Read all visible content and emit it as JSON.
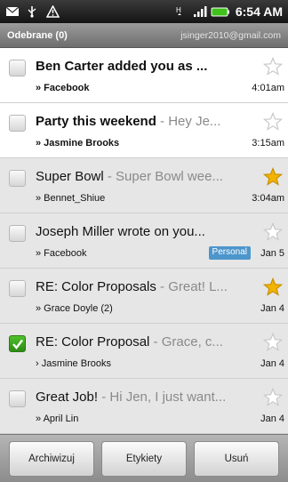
{
  "status_bar": {
    "time": "6:54 AM",
    "left_icons": [
      "mail-icon",
      "usb-icon",
      "warning-icon"
    ],
    "right_icons": [
      "data-icon",
      "signal-icon",
      "battery-icon"
    ]
  },
  "header": {
    "folder": "Odebrane (0)",
    "account": "jsinger2010@gmail.com"
  },
  "messages": [
    {
      "subject": "Ben Carter added you as ...",
      "snippet": "",
      "sender": "» Facebook",
      "time": "4:01am",
      "starred": false,
      "checked": false,
      "unread": true,
      "label": ""
    },
    {
      "subject": "Party this weekend",
      "snippet": " - Hey Je...",
      "sender": "» Jasmine Brooks",
      "time": "3:15am",
      "starred": false,
      "checked": false,
      "unread": true,
      "label": ""
    },
    {
      "subject": "Super Bowl",
      "snippet": " - Super Bowl wee...",
      "sender": "» Bennet_Shiue",
      "time": "3:04am",
      "starred": true,
      "checked": false,
      "unread": false,
      "label": ""
    },
    {
      "subject": "Joseph Miller wrote on you...",
      "snippet": "",
      "sender": "» Facebook",
      "time": "Jan 5",
      "starred": false,
      "checked": false,
      "unread": false,
      "label": "Personal"
    },
    {
      "subject": "RE: Color Proposals",
      "snippet": " - Great! L...",
      "sender": "» Grace Doyle (2)",
      "time": "Jan 4",
      "starred": true,
      "checked": false,
      "unread": false,
      "label": ""
    },
    {
      "subject": "RE: Color Proposal",
      "snippet": " - Grace, c...",
      "sender": "› Jasmine Brooks",
      "time": "Jan 4",
      "starred": false,
      "checked": true,
      "unread": false,
      "label": ""
    },
    {
      "subject": "Great Job!",
      "snippet": " - Hi Jen, I just want...",
      "sender": "» April Lin",
      "time": "Jan 4",
      "starred": false,
      "checked": false,
      "unread": false,
      "label": ""
    }
  ],
  "actions": {
    "archive": "Archiwizuj",
    "labels": "Etykiety",
    "delete": "Usuń"
  },
  "colors": {
    "star_on": "#f2b400",
    "star_off": "#c8c8c8",
    "checkbox_on": "#3aa51d",
    "label_badge": "#4d96cc"
  }
}
